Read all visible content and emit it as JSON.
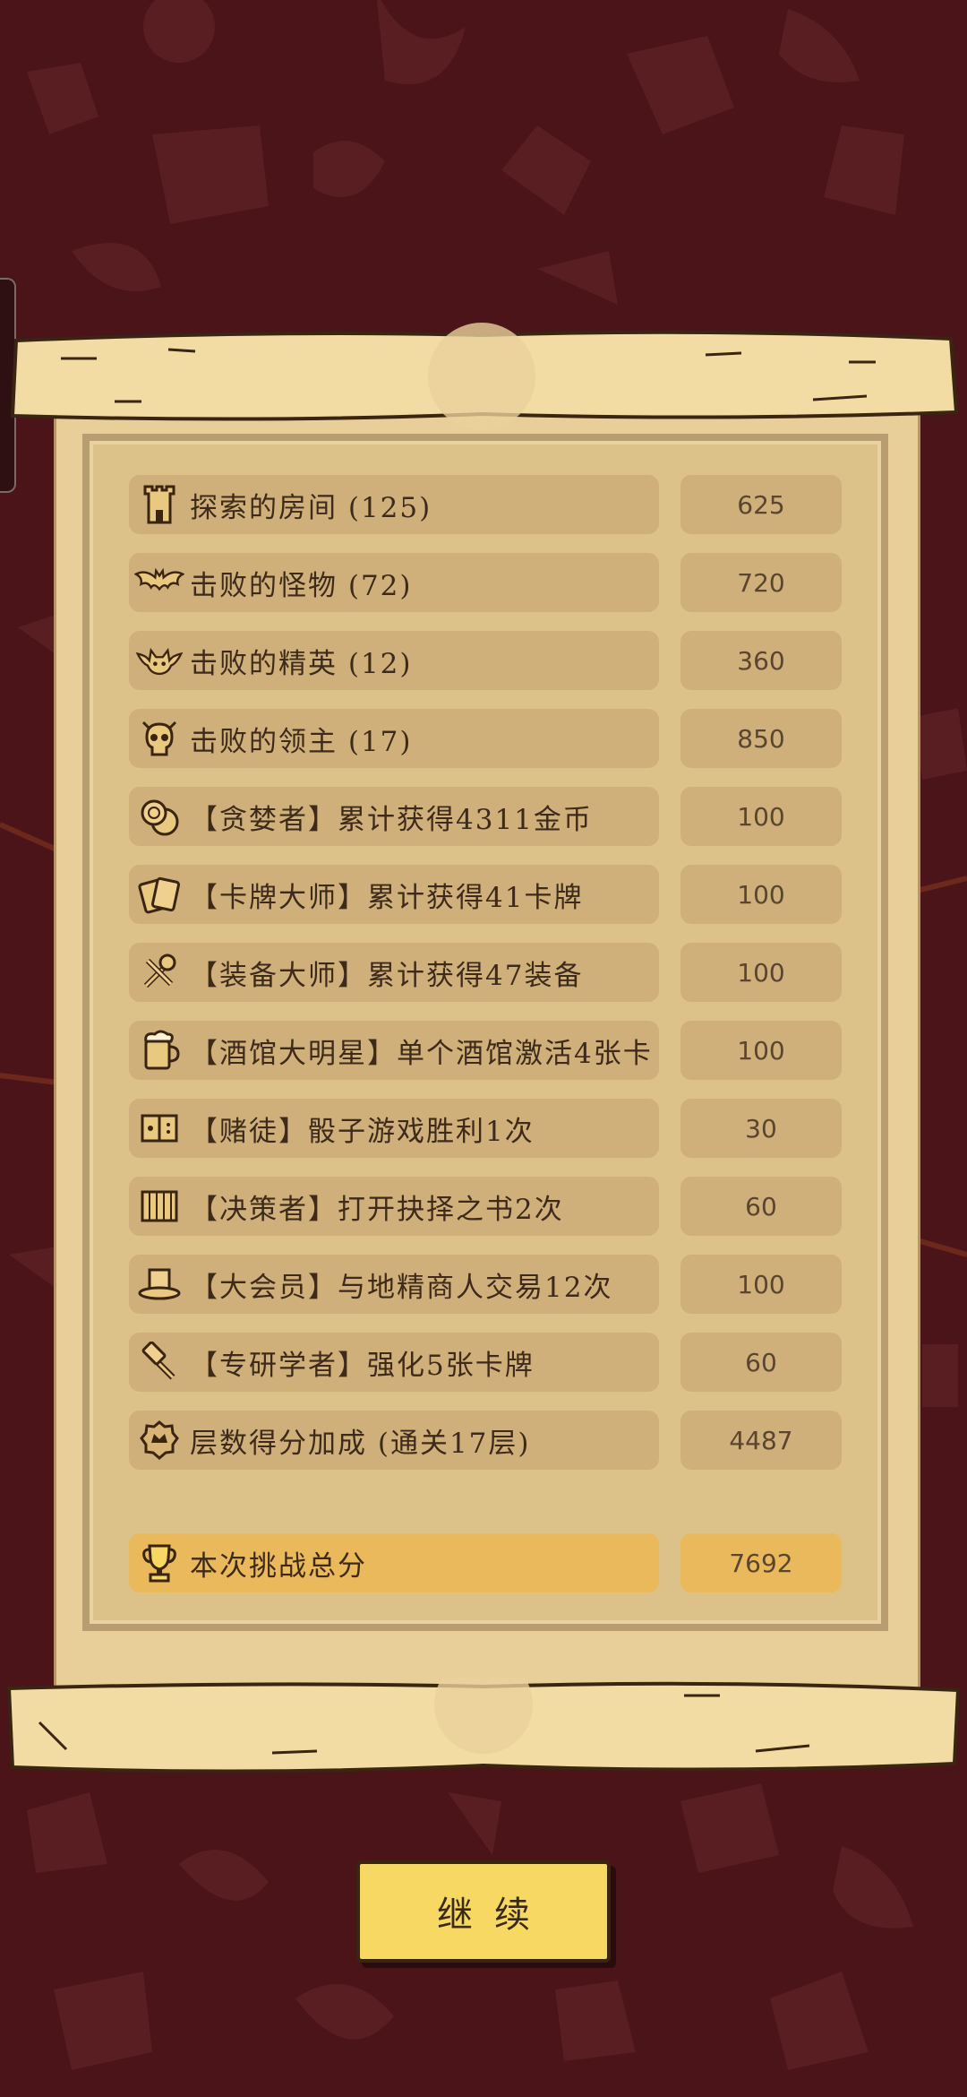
{
  "rows": [
    {
      "label": "探索的房间 (125)",
      "value": "625",
      "icon": "tower-icon"
    },
    {
      "label": "击败的怪物 (72)",
      "value": "720",
      "icon": "bat-icon"
    },
    {
      "label": "击败的精英 (12)",
      "value": "360",
      "icon": "demon-icon"
    },
    {
      "label": "击败的领主 (17)",
      "value": "850",
      "icon": "skull-icon"
    },
    {
      "label": "【贪婪者】累计获得4311金币",
      "value": "100",
      "icon": "coins-icon"
    },
    {
      "label": "【卡牌大师】累计获得41卡牌",
      "value": "100",
      "icon": "cards-icon"
    },
    {
      "label": "【装备大师】累计获得47装备",
      "value": "100",
      "icon": "tools-icon"
    },
    {
      "label": "【酒馆大明星】单个酒馆激活4张卡",
      "value": "100",
      "icon": "beer-mug-icon"
    },
    {
      "label": "【赌徒】骰子游戏胜利1次",
      "value": "30",
      "icon": "dice-book-icon"
    },
    {
      "label": "【决策者】打开抉择之书2次",
      "value": "60",
      "icon": "book-icon"
    },
    {
      "label": "【大会员】与地精商人交易12次",
      "value": "100",
      "icon": "top-hat-icon"
    },
    {
      "label": "【专研学者】强化5张卡牌",
      "value": "60",
      "icon": "hammer-icon"
    },
    {
      "label": "层数得分加成 (通关17层)",
      "value": "4487",
      "icon": "floor-badge-icon"
    }
  ],
  "total": {
    "label": "本次挑战总分",
    "value": "7692",
    "icon": "trophy-icon"
  },
  "continue_label": "继续",
  "colors": {
    "background": "#4a1418",
    "parchment": "#e8cf9a",
    "row": "#cfb07a",
    "total_row": "#eab95c",
    "button": "#f6d863"
  }
}
